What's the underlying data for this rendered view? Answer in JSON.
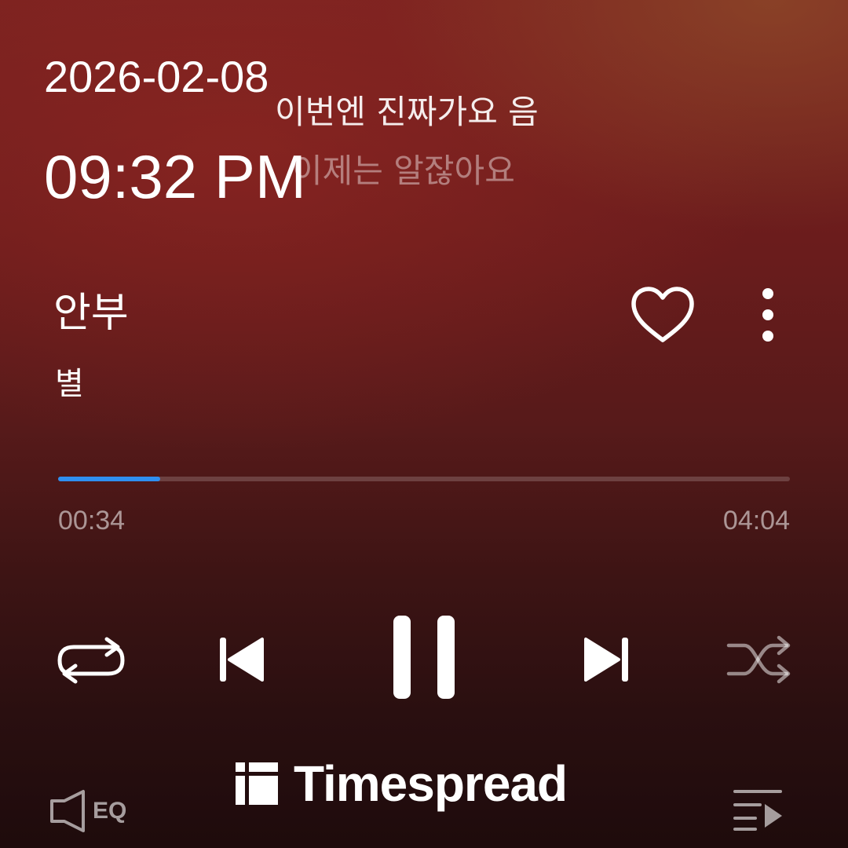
{
  "status": {
    "date": "2026-02-08",
    "time": "09:32 PM"
  },
  "lyrics": {
    "current": "이번엔 진짜가요 음",
    "next": "이제는 알잖아요"
  },
  "track": {
    "title": "안부",
    "artist": "별",
    "liked": false
  },
  "playback": {
    "elapsed": "00:34",
    "duration": "04:04",
    "progress_fraction": 0.139,
    "state": "playing"
  },
  "controls": {
    "repeat_icon": "repeat-icon",
    "previous_icon": "skip-previous-icon",
    "pause_icon": "pause-icon",
    "next_icon": "skip-next-icon",
    "shuffle_icon": "shuffle-icon"
  },
  "bottom_bar": {
    "eq_label": "EQ",
    "queue_icon": "playlist-icon"
  },
  "watermark": {
    "text": "Timespread"
  },
  "colors": {
    "progress": "#2f8ff0",
    "background_top": "#7a2220",
    "background_bottom": "#1e0b0c"
  }
}
